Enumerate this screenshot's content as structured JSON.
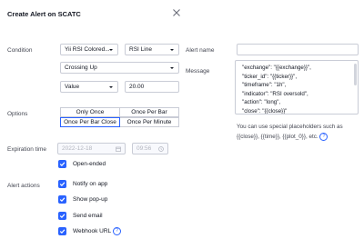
{
  "dialog": {
    "title": "Create Alert on SCATC"
  },
  "condition": {
    "label": "Condition",
    "source": "Yii RSI Colored...",
    "line": "RSI Line",
    "operator": "Crossing Up",
    "value_type": "Value",
    "value": "20.00"
  },
  "options": {
    "label": "Options",
    "buttons": [
      "Only Once",
      "Once Per Bar",
      "Once Per Bar Close",
      "Once Per Minute"
    ],
    "selected": "Once Per Bar Close"
  },
  "expiration": {
    "label": "Expiration time",
    "date": "2022-12-18",
    "time": "09:56",
    "open_ended_label": "Open-ended",
    "open_ended_checked": true
  },
  "alert_actions": {
    "label": "Alert actions",
    "items": [
      {
        "label": "Notify on app",
        "checked": true
      },
      {
        "label": "Show pop-up",
        "checked": true
      },
      {
        "label": "Send email",
        "checked": true
      },
      {
        "label": "Webhook URL",
        "checked": true
      }
    ]
  },
  "alert_name": {
    "label": "Alert name",
    "value": ""
  },
  "message": {
    "label": "Message",
    "text": "\"exchange\": \"{{exchange}}\",\n\"ticker_id\": \"{{ticker}}\",\n\"timeframe\": \"1h\",\n\"indicator\": \"RSI oversold\",\n\"action\": \"long\",\n\"close\": \"{{close}}\"",
    "hint_line1": "You can use special placeholders such as",
    "hint_line2": "{{close}}, {{time}}, {{plot_0}}, etc."
  },
  "colors": {
    "accent": "#2962ff",
    "border": "#c9ccd6",
    "text": "#131722"
  }
}
